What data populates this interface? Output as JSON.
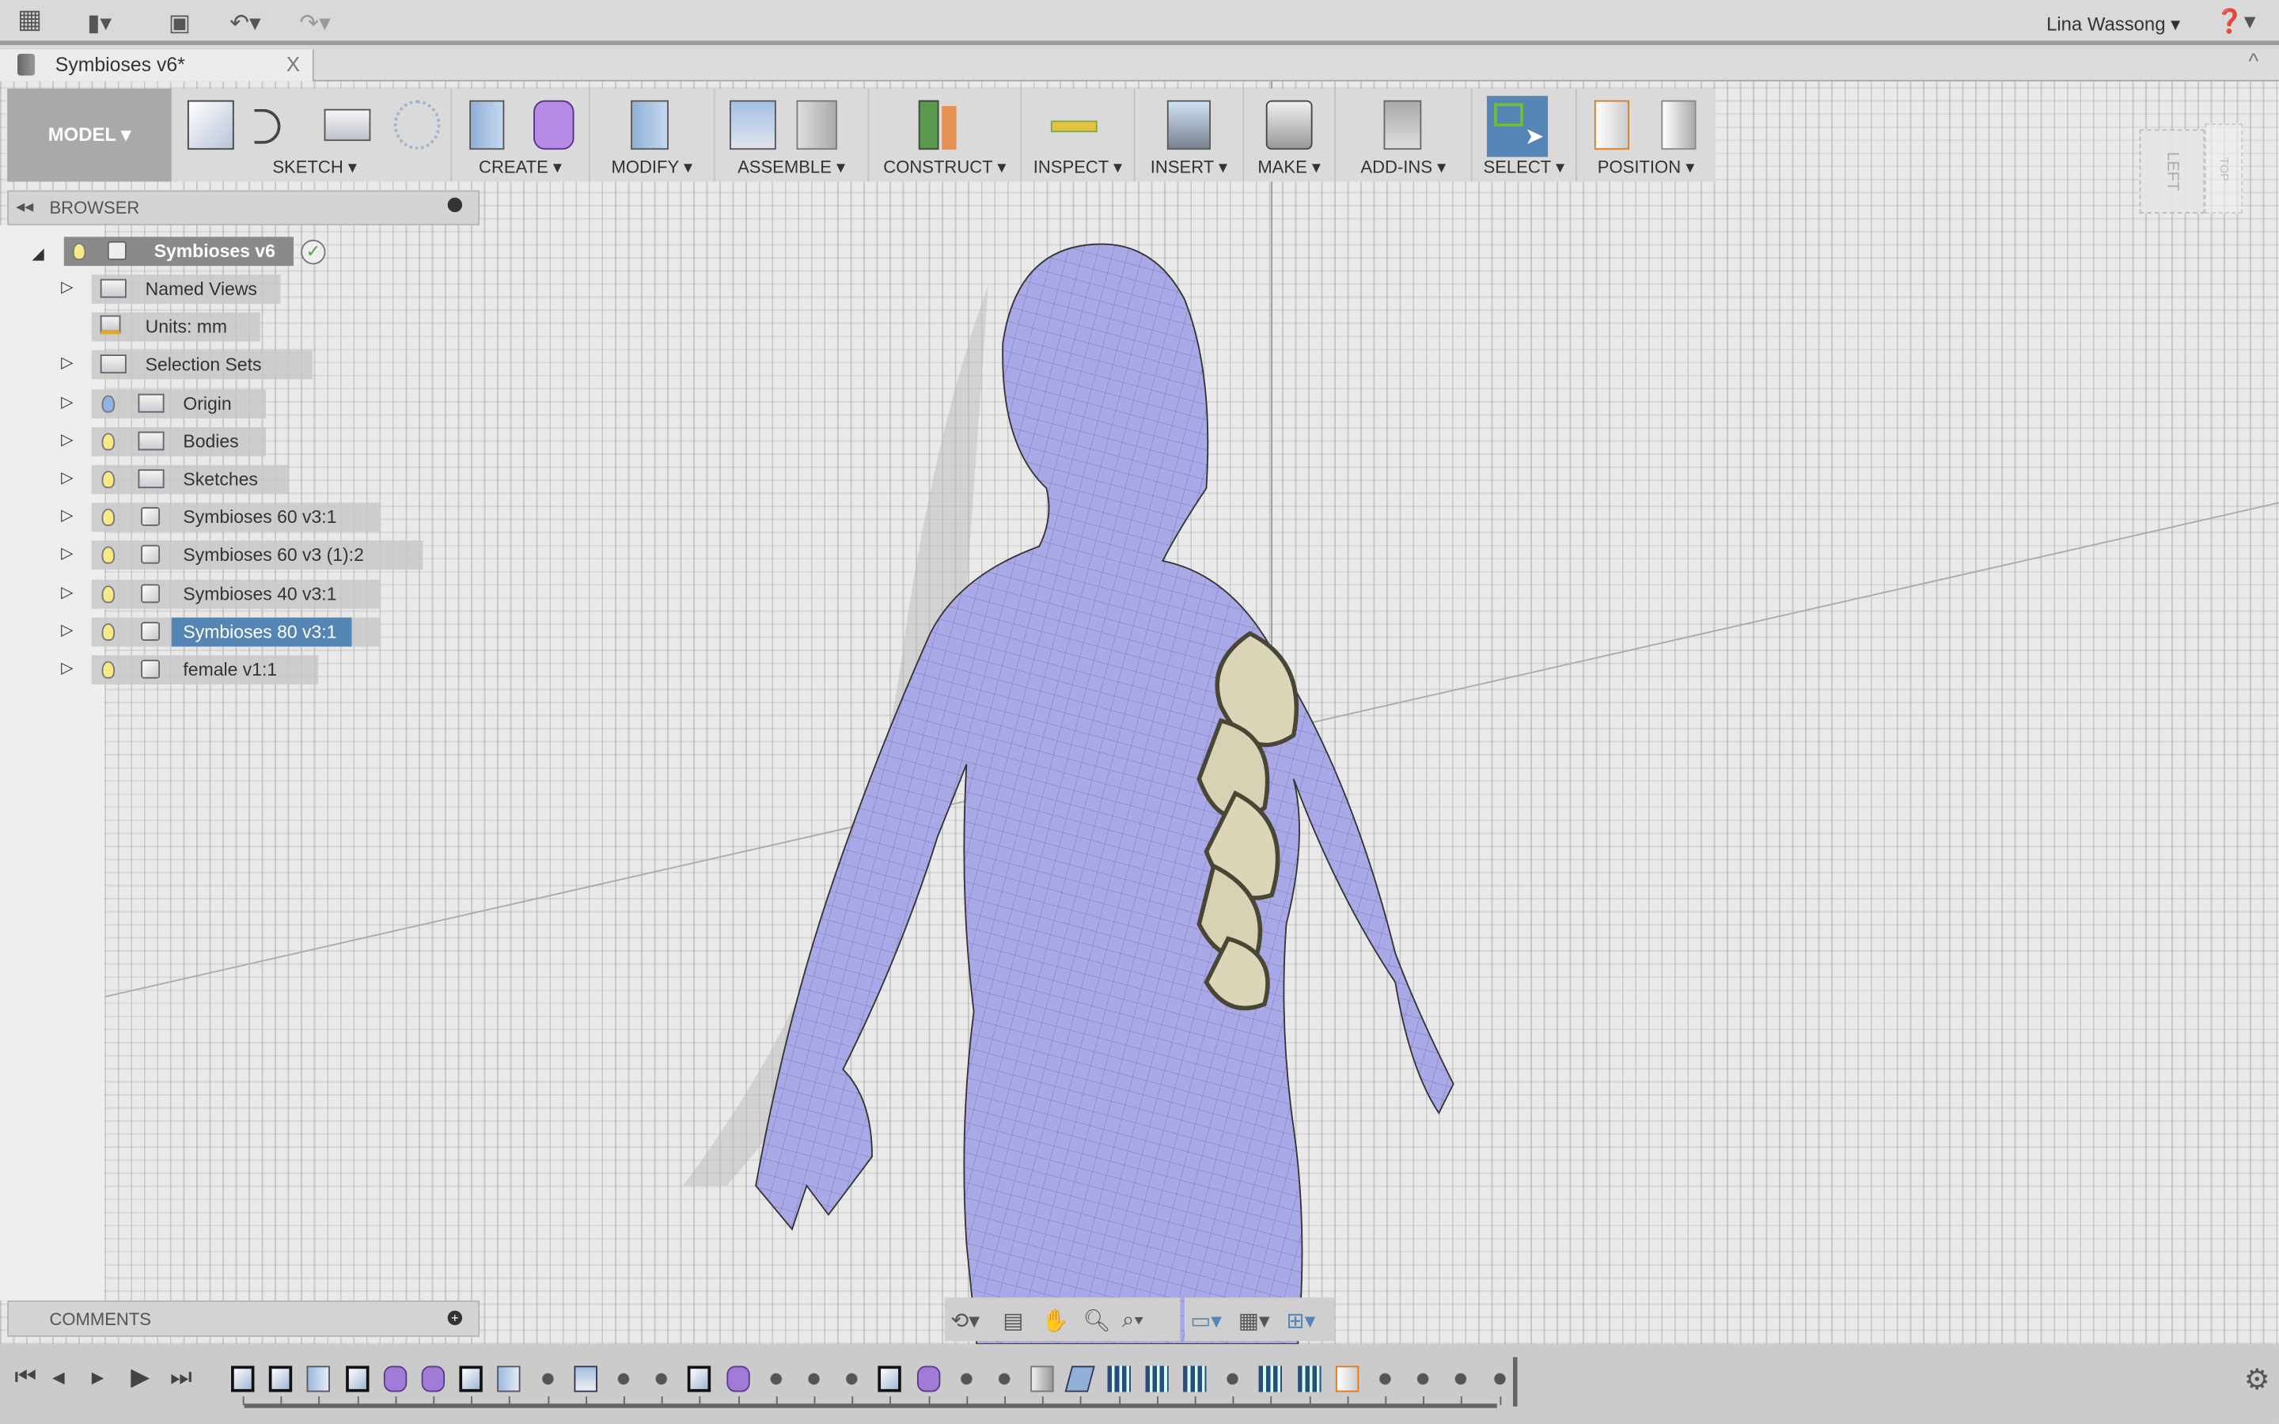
{
  "topbar": {
    "user": "Lina Wassong",
    "icons": [
      "grid-apps-icon",
      "file-icon",
      "save-icon",
      "undo-icon",
      "redo-icon",
      "help-icon"
    ]
  },
  "tab": {
    "title": "Symbioses v6*",
    "close": "X"
  },
  "toolbar": {
    "workspace": "MODEL ▾",
    "groups": [
      {
        "label": "SKETCH ▾",
        "icons": [
          "create-sketch-icon",
          "arc-icon",
          "rectangle-icon",
          "sketch-pattern-icon"
        ]
      },
      {
        "label": "CREATE ▾",
        "icons": [
          "extrude-icon",
          "create-form-icon"
        ]
      },
      {
        "label": "MODIFY ▾",
        "icons": [
          "press-pull-icon"
        ]
      },
      {
        "label": "ASSEMBLE ▾",
        "icons": [
          "new-component-icon",
          "joint-icon"
        ]
      },
      {
        "label": "CONSTRUCT ▾",
        "icons": [
          "offset-plane-icon"
        ]
      },
      {
        "label": "INSPECT ▾",
        "icons": [
          "measure-icon"
        ]
      },
      {
        "label": "INSERT ▾",
        "icons": [
          "insert-image-icon"
        ]
      },
      {
        "label": "MAKE ▾",
        "icons": [
          "3d-print-icon"
        ]
      },
      {
        "label": "ADD-INS ▾",
        "icons": [
          "scripts-addins-icon"
        ]
      },
      {
        "label": "SELECT ▾",
        "icons": [
          "select-icon"
        ]
      },
      {
        "label": "POSITION ▾",
        "icons": [
          "capture-position-icon",
          "revert-position-icon"
        ]
      }
    ]
  },
  "browser": {
    "title": "BROWSER",
    "root": "Symbioses v6",
    "items": [
      {
        "label": "Named Views",
        "type": "folder",
        "bulb": false
      },
      {
        "label": "Units: mm",
        "type": "units",
        "bulb": false
      },
      {
        "label": "Selection Sets",
        "type": "folder",
        "bulb": false
      },
      {
        "label": "Origin",
        "type": "folder",
        "bulb": true,
        "bulb_color": "#8fb4e3"
      },
      {
        "label": "Bodies",
        "type": "folder",
        "bulb": true
      },
      {
        "label": "Sketches",
        "type": "folder",
        "bulb": true
      },
      {
        "label": "Symbioses 60 v3:1",
        "type": "component",
        "bulb": true
      },
      {
        "label": "Symbioses 60 v3 (1):2",
        "type": "component",
        "bulb": true
      },
      {
        "label": "Symbioses 40 v3:1",
        "type": "component",
        "bulb": true
      },
      {
        "label": "Symbioses 80 v3:1",
        "type": "component",
        "bulb": true,
        "selected": true
      },
      {
        "label": "female v1:1",
        "type": "component",
        "bulb": true
      }
    ]
  },
  "viewcube": {
    "face": "LEFT",
    "corner": "TOP"
  },
  "comments": {
    "title": "COMMENTS"
  },
  "timeline": {
    "features": [
      "sketch",
      "sketch",
      "extrude",
      "sketch",
      "form",
      "form",
      "sketch",
      "extrude",
      "move",
      "box",
      "move",
      "move",
      "sketch",
      "form",
      "move",
      "move",
      "move",
      "sketch",
      "form",
      "move",
      "move",
      "joint",
      "rigid-group",
      "group",
      "group",
      "group",
      "move",
      "group",
      "group",
      "position",
      "move",
      "move",
      "move",
      "move"
    ]
  },
  "colors": {
    "accent": "#5b8ab8",
    "body": "#a9a9e8",
    "select_bg": "#5585b5"
  }
}
